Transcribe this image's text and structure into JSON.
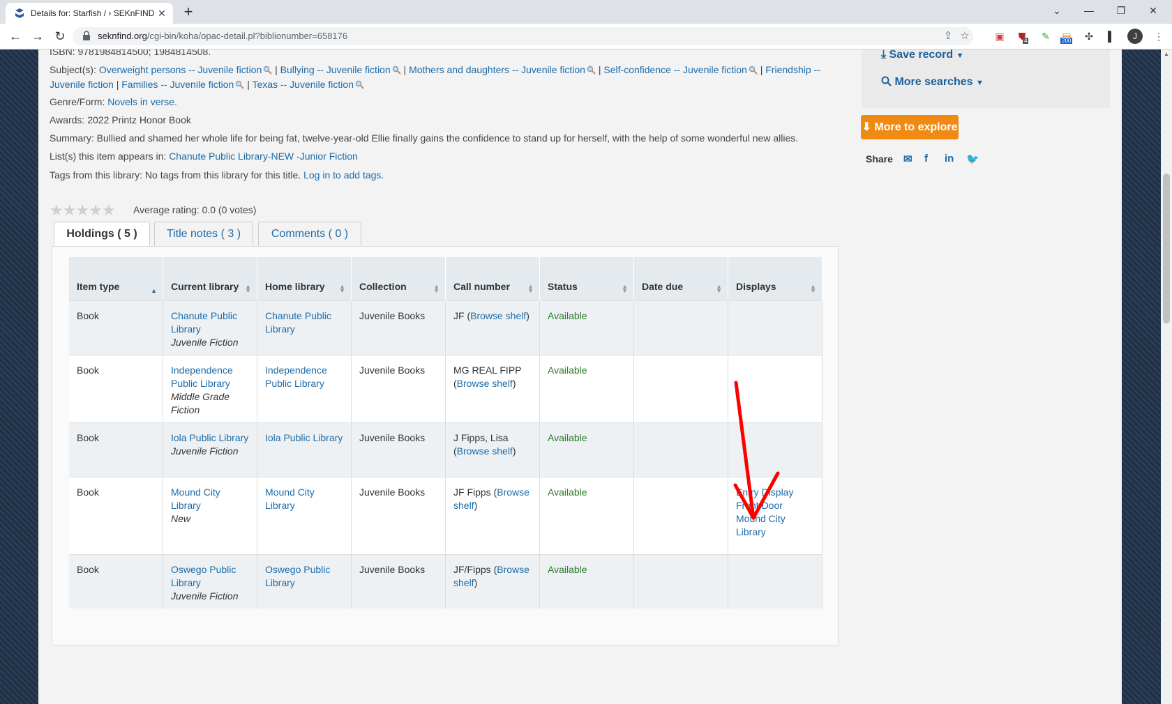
{
  "browser": {
    "tab_title": "Details for: Starfish / › SEKnFIND",
    "url_host": "seknfind.org",
    "url_path": "/cgi-bin/koha/opac-detail.pl?biblionumber=658176",
    "profile_initial": "J",
    "ext_badge_1": "4",
    "ext_badge_2": "200"
  },
  "record": {
    "isbn_line": "ISBN: 9781984814500; 1984814508.",
    "subjects_label": "Subject(s):",
    "subjects": [
      "Overweight persons -- Juvenile fiction",
      "Bullying -- Juvenile fiction",
      "Mothers and daughters -- Juvenile fiction",
      "Self-confidence -- Juvenile fiction",
      "Friendship -- Juvenile fiction",
      "Families -- Juvenile fiction",
      "Texas -- Juvenile fiction"
    ],
    "genre_label": "Genre/Form:",
    "genre_value": "Novels in verse.",
    "awards": "Awards: 2022 Printz Honor Book",
    "summary": "Summary: Bullied and shamed her whole life for being fat, twelve-year-old Ellie finally gains the confidence to stand up for herself, with the help of some wonderful new allies.",
    "lists_label": "List(s) this item appears in:",
    "lists_value": "Chanute Public Library-NEW -Junior Fiction",
    "tags_text": "Tags from this library: No tags from this library for this title.",
    "tags_link": "Log in to add tags.",
    "rating_text": "Average rating: 0.0 (0 votes)",
    "rating_value": 0
  },
  "sidebar": {
    "save_record": "Save record",
    "more_searches": "More searches",
    "more_to_explore": "More to explore",
    "share_label": "Share"
  },
  "tabs": [
    {
      "label": "Holdings ( 5 )",
      "active": true
    },
    {
      "label": "Title notes ( 3 )",
      "active": false
    },
    {
      "label": "Comments ( 0 )",
      "active": false
    }
  ],
  "holdings": {
    "headers": [
      "Item type",
      "Current library",
      "Home library",
      "Collection",
      "Call number",
      "Status",
      "Date due",
      "Displays"
    ],
    "rows": [
      {
        "item_type": "Book",
        "current_library": "Chanute Public Library",
        "current_sub": "Juvenile Fiction",
        "home_library": "Chanute Public Library",
        "collection": "Juvenile Books",
        "call_prefix": "JF (",
        "call_link": "Browse shelf",
        "call_suffix": ")",
        "status": "Available",
        "date_due": "",
        "displays": ""
      },
      {
        "item_type": "Book",
        "current_library": "Independence Public Library",
        "current_sub": "Middle Grade Fiction",
        "home_library": "Independence Public Library",
        "collection": "Juvenile Books",
        "call_prefix": "MG REAL FIPP (",
        "call_link": "Browse shelf",
        "call_suffix": ")",
        "status": "Available",
        "date_due": "",
        "displays": ""
      },
      {
        "item_type": "Book",
        "current_library": "Iola Public Library",
        "current_sub": "Juvenile Fiction",
        "home_library": "Iola Public Library",
        "collection": "Juvenile Books",
        "call_prefix": "J Fipps, Lisa (",
        "call_link": "Browse shelf",
        "call_suffix": ")",
        "status": "Available",
        "date_due": "",
        "displays": ""
      },
      {
        "item_type": "Book",
        "current_library": "Mound City Library",
        "current_sub": "New",
        "home_library": "Mound City Library",
        "collection": "Juvenile Books",
        "call_prefix": "JF Fipps (",
        "call_link": "Browse shelf",
        "call_suffix": ")",
        "status": "Available",
        "date_due": "",
        "displays": "Entry Display Front Door Mound City Library"
      },
      {
        "item_type": "Book",
        "current_library": "Oswego Public Library",
        "current_sub": "Juvenile Fiction",
        "home_library": "Oswego Public Library",
        "collection": "Juvenile Books",
        "call_prefix": "JF/Fipps (",
        "call_link": "Browse shelf",
        "call_suffix": ")",
        "status": "Available",
        "date_due": "",
        "displays": ""
      }
    ]
  },
  "colors": {
    "link": "#1c6ba8",
    "available": "#2b7a2b",
    "explore_button": "#f08a13",
    "annotation_arrow": "#ff0000"
  }
}
